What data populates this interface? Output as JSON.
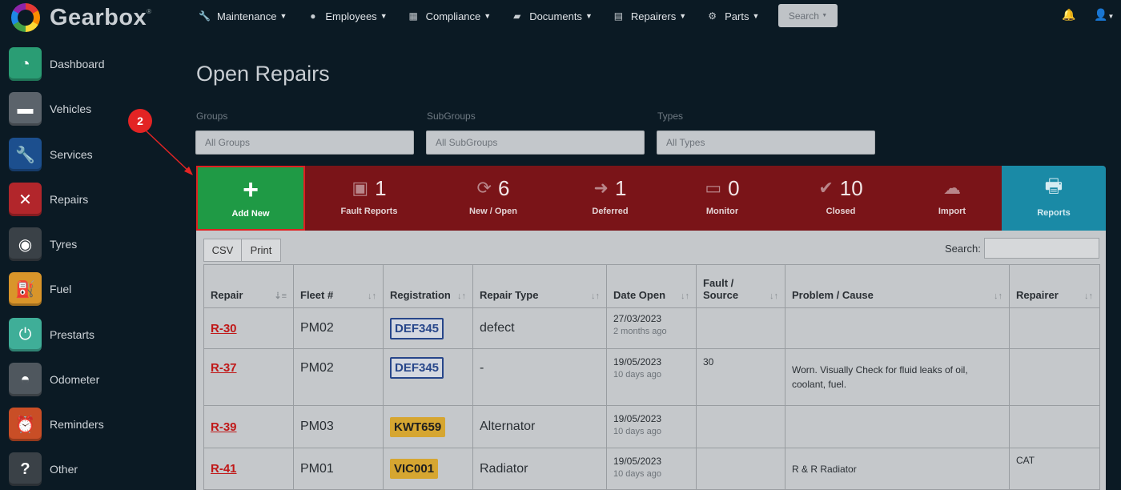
{
  "app": {
    "name": "Gearbox",
    "trademark": "®"
  },
  "nav": {
    "items": [
      {
        "label": "Maintenance",
        "icon": "wrench-icon"
      },
      {
        "label": "Employees",
        "icon": "user-circle-icon"
      },
      {
        "label": "Compliance",
        "icon": "calendar-icon"
      },
      {
        "label": "Documents",
        "icon": "folder-icon"
      },
      {
        "label": "Repairers",
        "icon": "contact-book-icon"
      },
      {
        "label": "Parts",
        "icon": "gear-icon"
      }
    ],
    "search_label": "Search"
  },
  "sidebar": {
    "items": [
      {
        "label": "Dashboard",
        "color": "#2a9d74"
      },
      {
        "label": "Vehicles",
        "color": "#5b636b"
      },
      {
        "label": "Services",
        "color": "#1c4f8e"
      },
      {
        "label": "Repairs",
        "color": "#b2262b"
      },
      {
        "label": "Tyres",
        "color": "#3a4147"
      },
      {
        "label": "Fuel",
        "color": "#d9952a"
      },
      {
        "label": "Prestarts",
        "color": "#3fae98"
      },
      {
        "label": "Odometer",
        "color": "#4f575e"
      },
      {
        "label": "Reminders",
        "color": "#c94e26"
      },
      {
        "label": "Other",
        "color": "#3a4147"
      }
    ]
  },
  "page": {
    "title": "Open Repairs"
  },
  "filters": {
    "groups": {
      "label": "Groups",
      "placeholder": "All Groups"
    },
    "subgroups": {
      "label": "SubGroups",
      "placeholder": "All SubGroups"
    },
    "types": {
      "label": "Types",
      "placeholder": "All Types"
    }
  },
  "tiles": {
    "add_new": "Add New",
    "fault_reports": {
      "count": "1",
      "label": "Fault Reports"
    },
    "new_open": {
      "count": "6",
      "label": "New / Open"
    },
    "deferred": {
      "count": "1",
      "label": "Deferred"
    },
    "monitor": {
      "count": "0",
      "label": "Monitor"
    },
    "closed": {
      "count": "10",
      "label": "Closed"
    },
    "import": {
      "label": "Import"
    },
    "reports": {
      "label": "Reports"
    }
  },
  "table_tools": {
    "csv": "CSV",
    "print": "Print",
    "search_label": "Search:"
  },
  "table": {
    "headers": {
      "repair": "Repair",
      "fleet": "Fleet #",
      "registration": "Registration",
      "repair_type": "Repair Type",
      "date_open": "Date Open",
      "fault_source_1": "Fault /",
      "fault_source_2": "Source",
      "problem_cause": "Problem / Cause",
      "repairer": "Repairer"
    },
    "rows": [
      {
        "repair": "R-30",
        "fleet": "PM02",
        "registration": "DEF345",
        "repair_type": "defect",
        "date": "27/03/2023",
        "ago": "2 months ago",
        "fault": "",
        "problem": "",
        "repairer": ""
      },
      {
        "repair": "R-37",
        "fleet": "PM02",
        "registration": "DEF345",
        "repair_type": "-",
        "date": "19/05/2023",
        "ago": "10 days ago",
        "fault": "30",
        "problem": "Worn. Visually Check for fluid leaks of oil, coolant, fuel.",
        "repairer": ""
      },
      {
        "repair": "R-39",
        "fleet": "PM03",
        "registration": "KWT659",
        "repair_type": "Alternator",
        "date": "19/05/2023",
        "ago": "10 days ago",
        "fault": "",
        "problem": "",
        "repairer": ""
      },
      {
        "repair": "R-41",
        "fleet": "PM01",
        "registration": "VIC001",
        "repair_type": "Radiator",
        "date": "19/05/2023",
        "ago": "10 days ago",
        "fault": "",
        "problem": "R & R Radiator",
        "repairer": "CAT"
      }
    ]
  },
  "annotation": {
    "step": "2"
  }
}
